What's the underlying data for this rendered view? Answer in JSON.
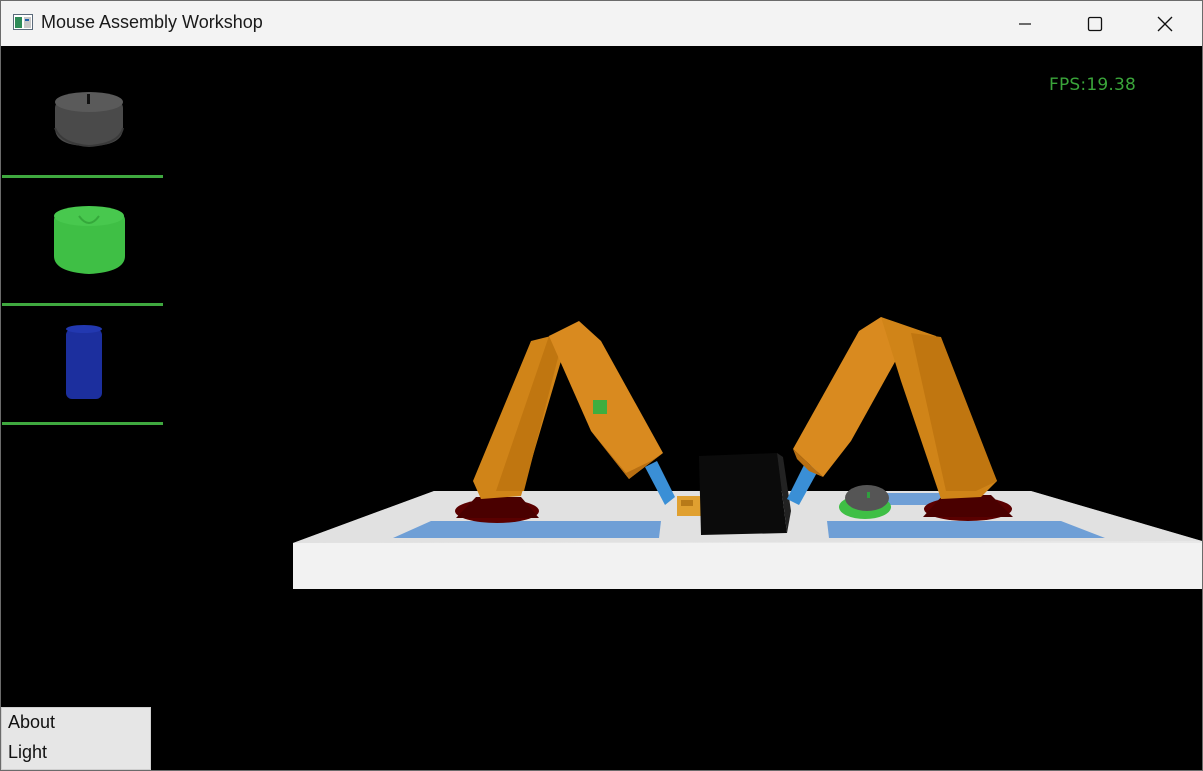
{
  "window": {
    "title": "Mouse Assembly Workshop",
    "controls": [
      "minimize",
      "maximize",
      "close"
    ]
  },
  "overlay": {
    "fps_text": "FPS:19.38"
  },
  "palette": {
    "items": [
      {
        "name": "dark-gray-mouse-shell-part",
        "color": "#4a4a4a"
      },
      {
        "name": "green-mouse-shell-part",
        "color": "#3fbf45"
      },
      {
        "name": "blue-cylinder-part",
        "color": "#1c2f9e"
      }
    ],
    "separator_color": "#3fa83f"
  },
  "menu": {
    "items": [
      "About",
      "Light"
    ]
  },
  "scene": {
    "arm_color": "#d98a1f",
    "base_color": "#5a0000",
    "effector_color": "#3a8fd6",
    "table_color": "#e9e9e9",
    "pad_color": "#6f9fd6"
  }
}
